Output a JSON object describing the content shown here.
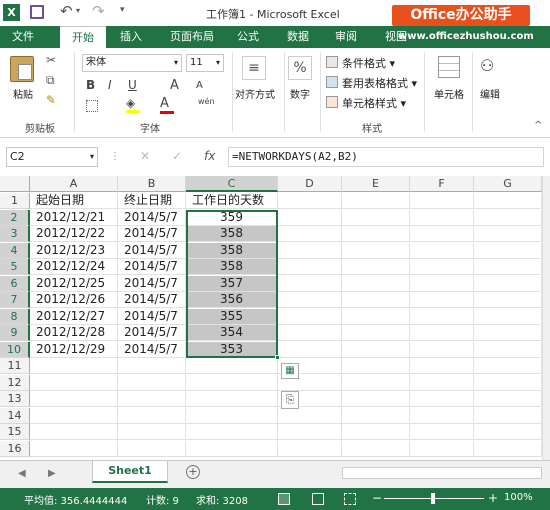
{
  "window": {
    "title": "工作簿1 - Microsoft Excel",
    "watermark_brand": "Office办公助手",
    "watermark_url": "www.officezhushou.com"
  },
  "tabs": [
    {
      "label": "文件",
      "active": false
    },
    {
      "label": "开始",
      "active": true
    },
    {
      "label": "插入",
      "active": false
    },
    {
      "label": "页面布局",
      "active": false
    },
    {
      "label": "公式",
      "active": false
    },
    {
      "label": "数据",
      "active": false
    },
    {
      "label": "审阅",
      "active": false
    },
    {
      "label": "视图",
      "active": false
    }
  ],
  "ribbon": {
    "paste": "粘贴",
    "clipboard": "剪贴板",
    "font_name": "宋体",
    "font_size": "11",
    "font_group": "字体",
    "bold": "B",
    "italic": "I",
    "underline": "U",
    "grow": "A",
    "shrink": "A",
    "wen": "wén",
    "align": "对齐方式",
    "number": "数字",
    "percent": "%",
    "cond_format": "条件格式",
    "table_format": "套用表格格式",
    "cell_style": "单元格样式",
    "style_group": "样式",
    "cells": "单元格",
    "edit": "编辑"
  },
  "formula_bar": {
    "name_box": "C2",
    "fx": "fx",
    "formula": "=NETWORKDAYS(A2,B2)"
  },
  "columns": [
    "A",
    "B",
    "C",
    "D",
    "E",
    "F",
    "G"
  ],
  "rows": [
    "1",
    "2",
    "3",
    "4",
    "5",
    "6",
    "7",
    "8",
    "9",
    "10",
    "11",
    "12",
    "13",
    "14",
    "15",
    "16"
  ],
  "table": {
    "headers": [
      "起始日期",
      "终止日期",
      "工作日的天数"
    ],
    "rows": [
      [
        "2012/12/21",
        "2014/5/7",
        "359"
      ],
      [
        "2012/12/22",
        "2014/5/7",
        "358"
      ],
      [
        "2012/12/23",
        "2014/5/7",
        "358"
      ],
      [
        "2012/12/24",
        "2014/5/7",
        "358"
      ],
      [
        "2012/12/25",
        "2014/5/7",
        "357"
      ],
      [
        "2012/12/26",
        "2014/5/7",
        "356"
      ],
      [
        "2012/12/27",
        "2014/5/7",
        "355"
      ],
      [
        "2012/12/28",
        "2014/5/7",
        "354"
      ],
      [
        "2012/12/29",
        "2014/5/7",
        "353"
      ]
    ]
  },
  "sheet_tab": "Sheet1",
  "status": {
    "average": "平均值: 356.4444444",
    "count": "计数: 9",
    "sum": "求和: 3208",
    "zoom": "100%"
  },
  "colors": {
    "excel_green": "#217346",
    "watermark_orange": "#e8501e"
  }
}
